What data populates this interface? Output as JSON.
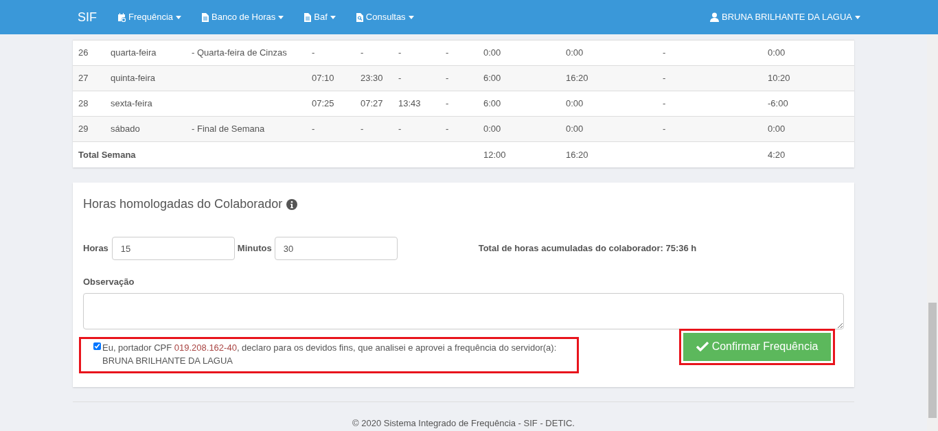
{
  "navbar": {
    "brand": "SIF",
    "menus": [
      {
        "label": "Frequência",
        "kind": "calendar"
      },
      {
        "label": "Banco de Horas",
        "kind": "document"
      },
      {
        "label": "Baf",
        "kind": "document"
      },
      {
        "label": "Consultas",
        "kind": "search"
      }
    ],
    "user": "BRUNA BRILHANTE DA LAGUA"
  },
  "table": {
    "rows": [
      {
        "column_1": "26",
        "column_2": "quarta-feira",
        "column_3": "- Quarta-feira de Cinzas",
        "column_4": "-",
        "column_5": "-",
        "column_6": "-",
        "column_7": "-",
        "column_8": "0:00",
        "column_9": "0:00",
        "column_10": "-",
        "column_11": "0:00"
      },
      {
        "column_1": "27",
        "column_2": "quinta-feira",
        "column_4": "07:10",
        "column_5": "23:30",
        "column_6": "-",
        "column_7": "-",
        "column_8": "6:00",
        "column_9": "16:20",
        "column_10": "-",
        "column_11": "10:20"
      },
      {
        "column_1": "28",
        "column_2": "sexta-feira",
        "column_4": "07:25",
        "column_5": "07:27",
        "column_6": "13:43",
        "column_7": "-",
        "column_8": "6:00",
        "column_9": "0:00",
        "column_10": "-",
        "column_11": "-6:00"
      },
      {
        "column_1": "29",
        "column_2": "sábado",
        "column_3": "- Final de Semana",
        "column_4": "-",
        "column_5": "-",
        "column_6": "-",
        "column_7": "-",
        "column_8": "0:00",
        "column_9": "0:00",
        "column_10": "-",
        "column_11": "0:00"
      }
    ],
    "total": {
      "column_1": "Total Semana",
      "column_8": "12:00",
      "column_9": "16:20",
      "column_11": "4:20"
    }
  },
  "approval": {
    "title": "Horas homologadas do Colaborador",
    "hours_label": "Horas",
    "hours_value": "15",
    "minutes_label": "Minutos",
    "minutes_value": "30",
    "accumulated": "Total de horas acumuladas do colaborador: 75:36 h",
    "observation_label": "Observação",
    "declaration": {
      "checked": true,
      "text_before": "Eu, portador CPF ",
      "cpf": "019.208.162-40",
      "text_after": ", declaro para os devidos fins, que analisei e aprovei a frequência do servidor(a):",
      "name": "BRUNA BRILHANTE DA LAGUA"
    },
    "confirm_button": "Confirmar Frequência"
  },
  "footer": "© 2020 Sistema Integrado de Frequência - SIF - DETIC."
}
